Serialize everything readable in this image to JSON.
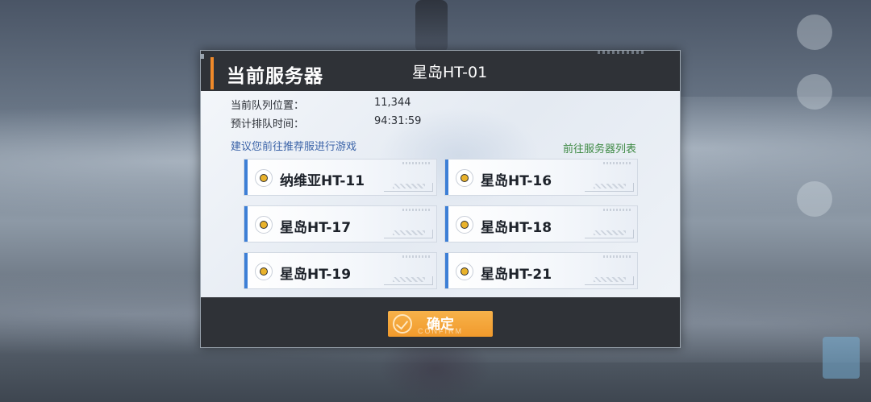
{
  "dialog": {
    "title": "当前服务器",
    "current_server": "星岛HT-01"
  },
  "queue": {
    "position_label": "当前队列位置：",
    "position_value": "11,344",
    "time_label": "预计排队时间：",
    "time_value": "94:31:59"
  },
  "suggest_text": "建议您前往推荐服进行游戏",
  "server_list_link": "前往服务器列表",
  "servers": [
    {
      "name": "纳维亚HT-11"
    },
    {
      "name": "星岛HT-16"
    },
    {
      "name": "星岛HT-17"
    },
    {
      "name": "星岛HT-18"
    },
    {
      "name": "星岛HT-19"
    },
    {
      "name": "星岛HT-21"
    }
  ],
  "confirm": {
    "label": "确定",
    "sub_label": "CONFIRM"
  },
  "colors": {
    "accent_orange": "#f08a2a",
    "card_accent_blue": "#3d7fd6",
    "link_green": "#3f8a45",
    "suggest_blue": "#3b63a8",
    "confirm_button": "#f19a2c"
  },
  "icons": [
    "server-status-icon",
    "confirm-check-icon"
  ]
}
